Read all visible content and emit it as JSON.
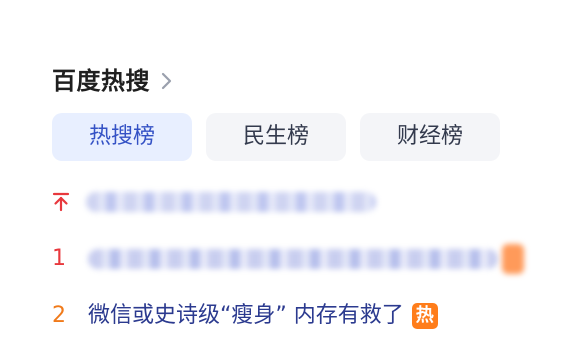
{
  "header": {
    "title": "百度热搜",
    "chevron_icon": "chevron-right-icon"
  },
  "tabs": [
    {
      "label": "热搜榜",
      "active": true
    },
    {
      "label": "民生榜",
      "active": false
    },
    {
      "label": "财经榜",
      "active": false
    }
  ],
  "list": {
    "pinned": {
      "icon": "pin-top-icon"
    },
    "items": [
      {
        "rank": "1"
      },
      {
        "rank": "2",
        "title": "微信或史诗级“瘦身” 内存有救了",
        "badge": "热"
      }
    ]
  },
  "colors": {
    "tab_active_bg": "#e8efff",
    "tab_active_text": "#3452c5",
    "rank_1": "#e8383d",
    "rank_2": "#f07a1a",
    "badge_hot": "#ff7d1a",
    "headline": "#2b3a8f"
  }
}
